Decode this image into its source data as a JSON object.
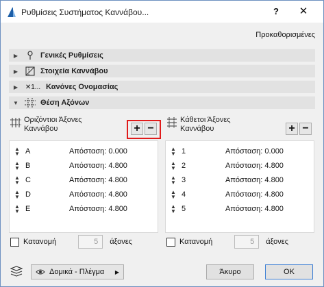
{
  "window": {
    "title": "Ρυθμίσεις Συστήματος Καννάβου...",
    "help_label": "?",
    "close_label": "✕"
  },
  "presets_label": "Προκαθορισμένες",
  "sections": [
    {
      "label": "Γενικές Ρυθμίσεις",
      "expanded": false,
      "icon": "pin-icon"
    },
    {
      "label": "Στοιχεία Καννάβου",
      "expanded": false,
      "icon": "grid-element-icon"
    },
    {
      "label": "Κανόνες Ονομασίας",
      "expanded": false,
      "icon": "naming-icon",
      "icon_text": "✕1..."
    },
    {
      "label": "Θέση Αξόνων",
      "expanded": true,
      "icon": "axis-position-icon"
    }
  ],
  "horizontal": {
    "title_line1": "Οριζόντιοι Άξονες",
    "title_line2": "Καννάβου",
    "add_label": "+",
    "remove_label": "−",
    "rows": [
      {
        "name": "A",
        "label": "Απόσταση: 0.000"
      },
      {
        "name": "B",
        "label": "Απόσταση: 4.800"
      },
      {
        "name": "C",
        "label": "Απόσταση: 4.800"
      },
      {
        "name": "D",
        "label": "Απόσταση: 4.800"
      },
      {
        "name": "E",
        "label": "Απόσταση: 4.800"
      }
    ],
    "distribute_label": "Κατανομή",
    "distribute_value": "5",
    "unit_label": "άξονες"
  },
  "vertical": {
    "title_line1": "Κάθετοι Άξονες",
    "title_line2": "Καννάβου",
    "add_label": "+",
    "remove_label": "−",
    "rows": [
      {
        "name": "1",
        "label": "Απόσταση: 0.000"
      },
      {
        "name": "2",
        "label": "Απόσταση: 4.800"
      },
      {
        "name": "3",
        "label": "Απόσταση: 4.800"
      },
      {
        "name": "4",
        "label": "Απόσταση: 4.800"
      },
      {
        "name": "5",
        "label": "Απόσταση: 4.800"
      }
    ],
    "distribute_label": "Κατανομή",
    "distribute_value": "5",
    "unit_label": "άξονες"
  },
  "footer": {
    "layer_value": "Δομικά - Πλέγμα",
    "cancel_label": "Άκυρο",
    "ok_label": "OK"
  },
  "colors": {
    "highlight": "#e01b1b",
    "section_bg": "#e2e2e2",
    "ok_border": "#3c7fd5"
  }
}
